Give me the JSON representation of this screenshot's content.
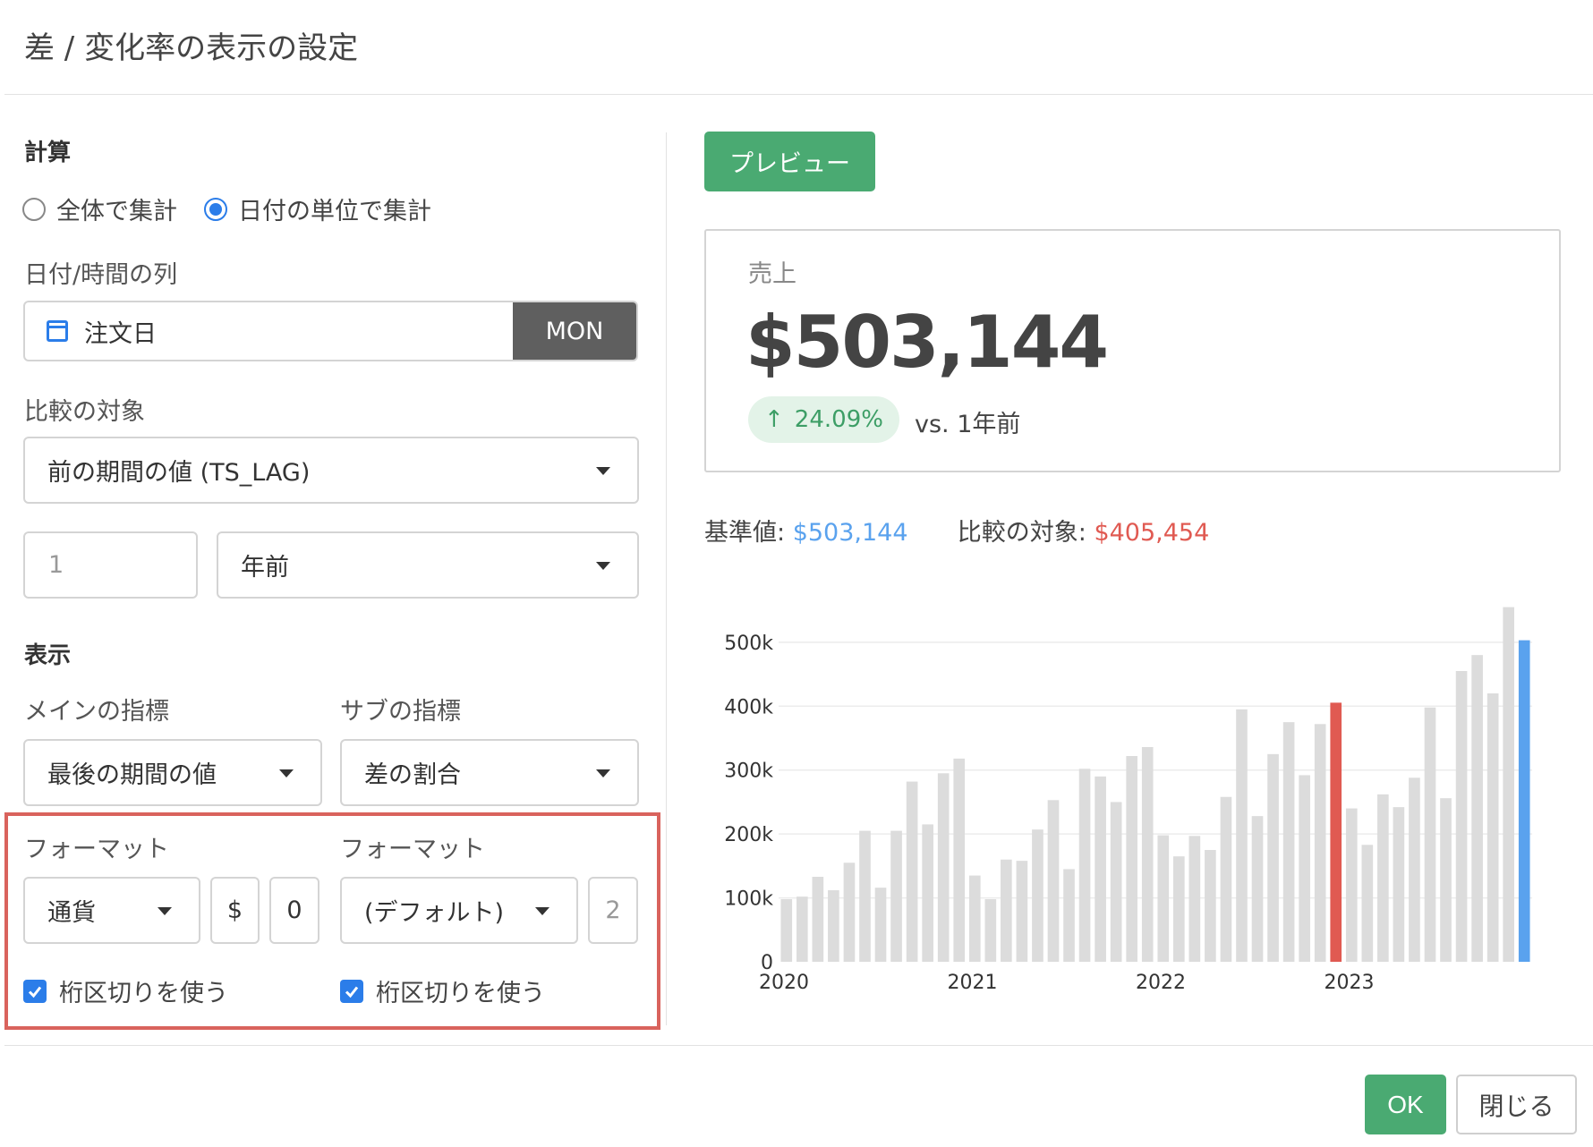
{
  "dialog": {
    "title": "差 / 変化率の表示の設定"
  },
  "calc": {
    "section_title": "計算",
    "radio_options": [
      {
        "label": "全体で集計",
        "selected": false
      },
      {
        "label": "日付の単位で集計",
        "selected": true
      }
    ],
    "date_column_label": "日付/時間の列",
    "date_column_value": "注文日",
    "date_unit": "MON",
    "compare_label": "比較の対象",
    "compare_value": "前の期間の値 (TS_LAG)",
    "lag_value": "1",
    "lag_unit": "年前"
  },
  "display": {
    "section_title": "表示",
    "main_metric_label": "メインの指標",
    "main_metric_value": "最後の期間の値",
    "sub_metric_label": "サブの指標",
    "sub_metric_value": "差の割合",
    "main_format_label": "フォーマット",
    "main_format_value": "通貨",
    "main_currency_symbol": "$",
    "main_decimals": "0",
    "main_separator_label": "桁区切りを使う",
    "sub_format_label": "フォーマット",
    "sub_format_value": "(デフォルト)",
    "sub_decimals": "2",
    "sub_separator_label": "桁区切りを使う"
  },
  "preview": {
    "button_label": "プレビュー",
    "kpi_label": "売上",
    "kpi_value": "$503,144",
    "change_arrow": "↑",
    "change_value": "24.09%",
    "change_suffix": "vs. 1年前",
    "base_label": "基準値:",
    "base_value": "$503,144",
    "target_label": "比較の対象:",
    "target_value": "$405,454"
  },
  "colors": {
    "accent_green": "#4aaa72",
    "base_blue": "#5aa2ee",
    "target_red": "#e05a52",
    "bar_gray": "#dcdcdc",
    "highlight_frame": "#d9635d"
  },
  "chart_data": {
    "type": "bar",
    "ylim": [
      0,
      560000
    ],
    "yticks": [
      0,
      100000,
      200000,
      300000,
      400000,
      500000
    ],
    "ytick_labels": [
      "0",
      "100k",
      "200k",
      "300k",
      "400k",
      "500k"
    ],
    "xtick_labels": [
      "2020",
      "2021",
      "2022",
      "2023"
    ],
    "xtick_index": [
      0,
      12,
      24,
      36
    ],
    "values": [
      98000,
      102000,
      133000,
      112000,
      155000,
      205000,
      116000,
      205000,
      282000,
      215000,
      295000,
      318000,
      135000,
      98000,
      160000,
      158000,
      207000,
      253000,
      145000,
      302000,
      290000,
      250000,
      322000,
      336000,
      198000,
      165000,
      197000,
      175000,
      258000,
      395000,
      228000,
      325000,
      375000,
      292000,
      372000,
      405454,
      240000,
      183000,
      262000,
      242000,
      288000,
      398000,
      256000,
      455000,
      480000,
      420000,
      555000,
      503144
    ],
    "base_index": 47,
    "target_index": 35
  },
  "footer": {
    "ok_label": "OK",
    "close_label": "閉じる"
  }
}
